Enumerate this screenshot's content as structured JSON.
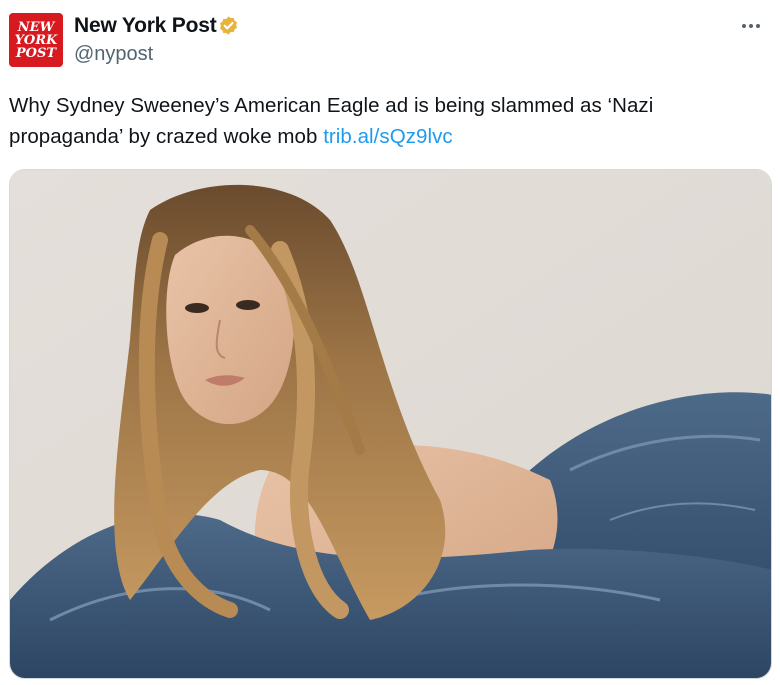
{
  "author": {
    "name": "New York Post",
    "handle": "@nypost",
    "avatar_logo": [
      "NEW",
      "YORK",
      "POST"
    ],
    "verified_icon": "verified-badge-gold-icon",
    "verified_color": "#e8b339"
  },
  "tweet": {
    "text": "Why Sydney Sweeney’s American Eagle ad is being slammed as ‘Nazi propaganda’ by crazed woke mob ",
    "link_text": "trib.al/sQz9lvc"
  },
  "menu_icon": "more-horizontal-icon",
  "colors": {
    "brand_red": "#d71920",
    "link": "#1d9bf0",
    "secondary_text": "#536471"
  },
  "media": {
    "type": "photo",
    "icon": "photo-image"
  }
}
